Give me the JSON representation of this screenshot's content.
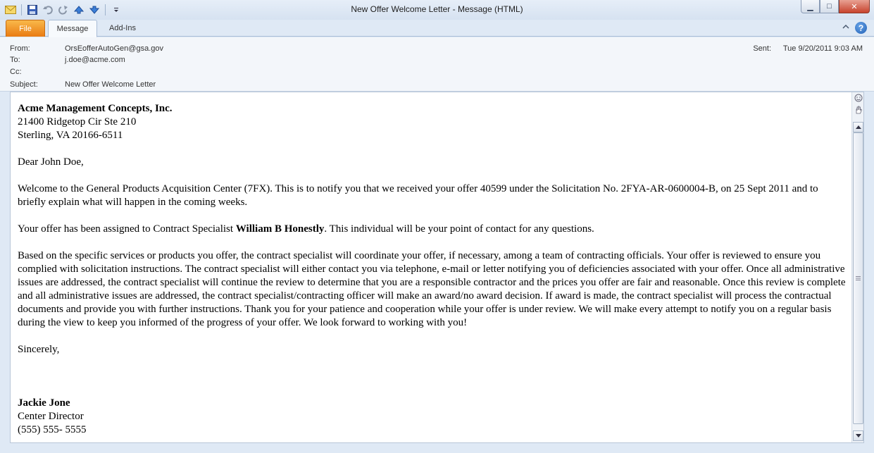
{
  "window": {
    "title": "New Offer Welcome Letter  -  Message (HTML)",
    "minimize_glyph": "▁",
    "maximize_glyph": "□",
    "close_glyph": "✕"
  },
  "qat": {
    "icons": [
      "mail-icon",
      "save-icon",
      "undo-icon",
      "redo-icon",
      "up-arrow-icon",
      "down-arrow-icon",
      "customize-icon"
    ]
  },
  "tabs": [
    {
      "label": "File"
    },
    {
      "label": "Message"
    },
    {
      "label": "Add-Ins"
    }
  ],
  "header": {
    "from_label": "From:",
    "from_value": "OrsEofferAutoGen@gsa.gov",
    "to_label": "To:",
    "to_value": "j.doe@acme.com",
    "cc_label": "Cc:",
    "cc_value": "",
    "subject_label": "Subject:",
    "subject_value": "New Offer Welcome Letter",
    "sent_label": "Sent:",
    "sent_value": "Tue 9/20/2011 9:03 AM"
  },
  "body": {
    "company": "Acme Management Concepts, Inc.",
    "address1": "21400 Ridgetop Cir Ste 210",
    "address2": "Sterling, VA 20166-6511",
    "greeting": "Dear John Doe,",
    "para1": "Welcome to the General Products Acquisition Center (7FX). This is to notify you that we received your offer 40599 under the Solicitation No. 2FYA-AR-0600004-B, on 25 Sept 2011 and to briefly explain what will happen in the coming weeks.",
    "para2_pre": "Your offer has been assigned to Contract Specialist ",
    "para2_name": "William B Honestly",
    "para2_post": ". This individual will be your point of contact for any questions.",
    "para3": "Based on the specific services or products you offer, the contract specialist will coordinate your offer, if necessary, among a team of contracting officials. Your offer is reviewed to ensure you complied with solicitation instructions. The contract specialist will either contact you via telephone, e-mail or letter notifying you of deficiencies associated with your offer. Once all administrative issues are addressed, the contract specialist will continue the review to determine that you are a responsible contractor and the prices you offer are fair and reasonable. Once this review is complete and all administrative issues are addressed, the contract specialist/contracting officer will make an award/no award decision. If award is made, the contract specialist will process the contractual documents and provide you with further instructions. Thank you for your patience and cooperation while your offer is under review. We will make every attempt to notify you on a regular basis during the view to keep you informed of the progress of your offer. We look forward to working with you!",
    "closing": "Sincerely,",
    "signer_name": "Jackie Jone",
    "signer_title": "Center Director",
    "signer_phone": "(555) 555- 5555"
  }
}
